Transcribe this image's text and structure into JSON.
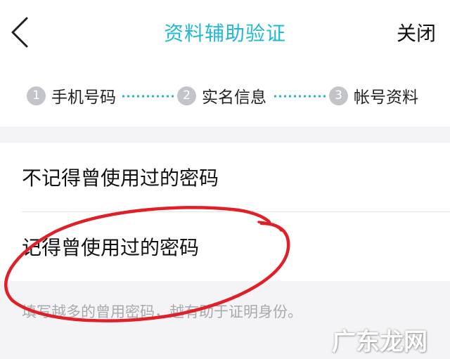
{
  "header": {
    "title": "资料辅助验证",
    "close_label": "关闭",
    "back_icon": "chevron-left-icon"
  },
  "steps": [
    {
      "num": "1",
      "label": "手机号码"
    },
    {
      "num": "2",
      "label": "实名信息"
    },
    {
      "num": "3",
      "label": "帐号资料"
    }
  ],
  "options": [
    {
      "label": "不记得曾使用过的密码"
    },
    {
      "label": "记得曾使用过的密码"
    }
  ],
  "hint": "填写越多的曾用密码，越有助于证明身份。",
  "watermark": "广东龙网",
  "colors": {
    "accent": "#1fb8d6",
    "annotation": "#e01f26",
    "step_circle": "#c3c4c9"
  }
}
